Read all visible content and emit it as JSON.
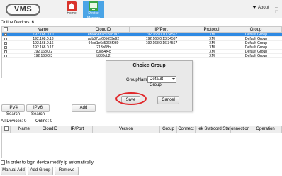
{
  "header": {
    "logo": "VMS",
    "nav": [
      {
        "label": "Home",
        "icon": "home-icon"
      },
      {
        "label": "Device Manage",
        "icon": "device-manage-icon"
      }
    ],
    "about_label": "About",
    "window_controls": "– □"
  },
  "online": {
    "label": "Online Devices: 6",
    "columns": [
      "Name",
      "CloudID",
      "IP/Port",
      "Protocol",
      "Group"
    ],
    "rows": [
      {
        "name": "192.168.0.10",
        "cloud": "eb645ab1c02e81a7",
        "ip": "192.168.0.10:34567",
        "protocol": "XM",
        "group": "Default Group",
        "selected": true
      },
      {
        "name": "192.168.0.13",
        "cloud": "adb87ca605659e92",
        "ip": "192.168.0.13:34567",
        "protocol": "XM",
        "group": "Default Group",
        "selected": false
      },
      {
        "name": "192.168.0.16",
        "cloud": "94ed1e6c5066f030",
        "ip": "192.168.0.16:34567",
        "protocol": "XM",
        "group": "Default Group",
        "selected": false
      },
      {
        "name": "192.168.0.17",
        "cloud": "213b68b",
        "ip": "",
        "protocol": "XM",
        "group": "Default Group",
        "selected": false
      },
      {
        "name": "192.168.0.2",
        "cloud": "c0854f4c",
        "ip": "",
        "protocol": "XM",
        "group": "Default Group",
        "selected": false
      },
      {
        "name": "192.168.0.3",
        "cloud": "b838cb2",
        "ip": "",
        "protocol": "XM",
        "group": "Default Group",
        "selected": false
      }
    ]
  },
  "search_buttons": {
    "ipv4": "IPV4 Search",
    "ipv6": "IPV6 Search",
    "add": "Add"
  },
  "all_devices": {
    "label": "All Devices:  0",
    "online_label": "Online:  0",
    "columns": [
      "Name",
      "CloudID",
      "IP/Port",
      "Version",
      "Group",
      "Connect",
      "Hek Status",
      "cord Stat",
      "onnection",
      "Operation"
    ]
  },
  "dialog": {
    "title": "Choice Group",
    "group_label": "GroupNam",
    "group_value": "Default Group",
    "save": "Save",
    "cancel": "Cancel"
  },
  "footer": {
    "auto_modify_label": "In order to login device,modify ip automatically",
    "manual_add": "Manual Add",
    "add_group": "Add Group",
    "remove": "Remove"
  },
  "colors": {
    "selection": "#2f8ae3",
    "nav_active": "#4aa4e6",
    "highlight_ring": "#e0272a"
  }
}
